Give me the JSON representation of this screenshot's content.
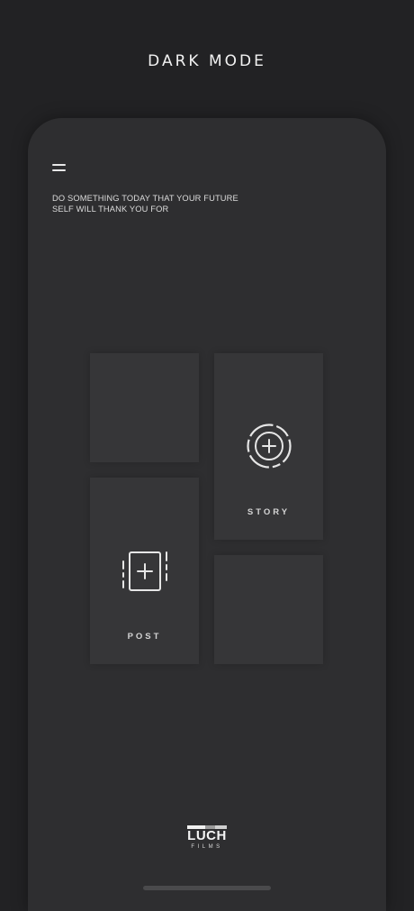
{
  "header": {
    "title": "DARK MODE"
  },
  "screen": {
    "quote": "DO SOMETHING TODAY THAT YOUR FUTURE SELF WILL THANK YOU FOR",
    "menu_icon": "hamburger-menu-icon"
  },
  "tiles": {
    "story": {
      "label": "STORY",
      "icon": "story-add-icon"
    },
    "post": {
      "label": "POST",
      "icon": "post-add-icon"
    }
  },
  "logo": {
    "word": "LUCH",
    "sub": "FILMS"
  },
  "colors": {
    "background": "#222224",
    "phone": "#2e2e30",
    "tile": "#363638",
    "text": "#f2f2f2"
  }
}
